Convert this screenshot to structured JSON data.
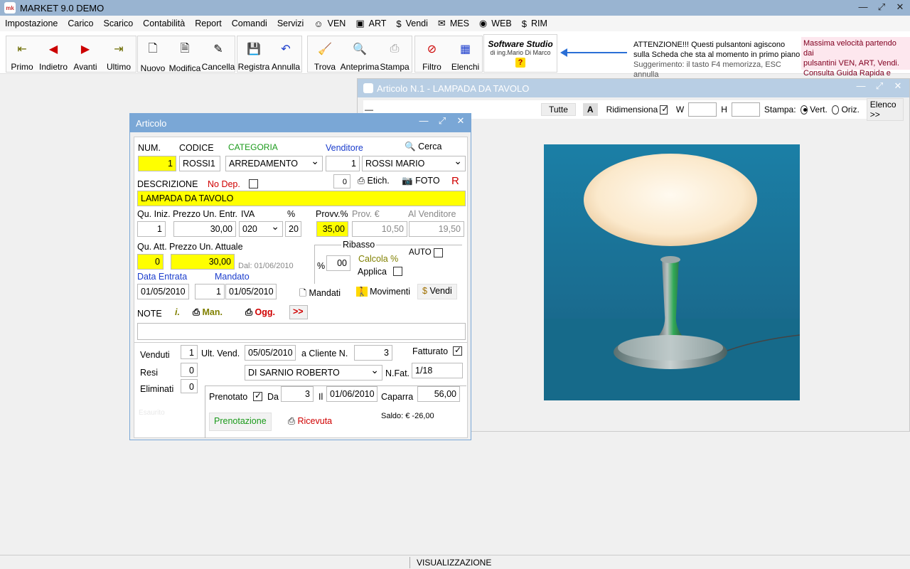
{
  "window": {
    "app_icon": "mk",
    "title": "MARKET 9.0   DEMO"
  },
  "menu": [
    {
      "label": "Impostazione",
      "icon": ""
    },
    {
      "label": "Carico",
      "icon": ""
    },
    {
      "label": "Scarico",
      "icon": ""
    },
    {
      "label": "Contabilità",
      "icon": ""
    },
    {
      "label": "Report",
      "icon": ""
    },
    {
      "label": "Comandi",
      "icon": ""
    },
    {
      "label": "Servizi",
      "icon": ""
    },
    {
      "label": "VEN",
      "icon": "☺"
    },
    {
      "label": "ART",
      "icon": "▣"
    },
    {
      "label": "Vendi",
      "icon": "$"
    },
    {
      "label": "MES",
      "icon": "✉"
    },
    {
      "label": "WEB",
      "icon": "◉"
    },
    {
      "label": "RIM",
      "icon": "$"
    }
  ],
  "toolbar": {
    "nav": [
      "Primo",
      "Indietro",
      "Avanti",
      "Ultimo"
    ],
    "edit": [
      "Nuovo",
      "Modifica",
      "Cancella"
    ],
    "save": [
      "Registra",
      "Annulla"
    ],
    "tools": [
      "Trova",
      "Anteprima",
      "Stampa"
    ],
    "filter": [
      "Filtro",
      "Elenchi"
    ],
    "brand_title": "Software Studio",
    "brand_sub": "di ing.Mario Di Marco",
    "help": "?",
    "attention_1": "ATTENZIONE!!! Questi pulsantoni agiscono",
    "attention_2": "sulla Scheda che sta al momento in primo piano",
    "attention_hint": "Suggerimento: il tasto F4 memorizza, ESC annulla",
    "pink_1": "Massima velocità partendo dai",
    "pink_2": "pulsantini VEN, ART, Vendi.",
    "pink_3": "Consulta Guida Rapida e Video"
  },
  "photo_window": {
    "title": "Articolo N.1 - LAMPADA DA TAVOLO",
    "tutte": "Tutte",
    "a": "A",
    "ridimensiona": "Ridimensiona",
    "w": "W",
    "h": "H",
    "stampa": "Stampa:",
    "vert": "Vert.",
    "oriz": "Oriz.",
    "elenco": "Elenco >>"
  },
  "articolo": {
    "title": "Articolo",
    "num_label": "NUM.",
    "num": "1",
    "codice_label": "CODICE",
    "codice": "ROSSI1",
    "categoria_label": "CATEGORIA",
    "categoria": "ARREDAMENTO",
    "venditore_label": "Venditore",
    "venditore_id": "1",
    "venditore": "ROSSI MARIO",
    "cerca": "Cerca",
    "descrizione_label": "DESCRIZIONE",
    "nodep_label": "No Dep.",
    "etich_count": "0",
    "etich": "Etich.",
    "foto": "FOTO",
    "r": "R",
    "descrizione": "LAMPADA DA TAVOLO",
    "qu_iniz_label": "Qu. Iniz.",
    "prezzo_entr_label": "Prezzo Un. Entr.",
    "iva_label": "IVA",
    "perc_label": "%",
    "provv_perc_label": "Provv.%",
    "provv_eur_label": "Prov. €",
    "al_vend_label": "Al Venditore",
    "qu_iniz": "1",
    "prezzo_entr": "30,00",
    "iva": "020",
    "perc": "20",
    "provv_perc": "35,00",
    "provv_eur": "10,50",
    "al_vend": "19,50",
    "qu_att_label": "Qu. Att.",
    "prezzo_att_label": "Prezzo Un. Attuale",
    "qu_att": "0",
    "prezzo_att": "30,00",
    "dal": "Dal: 01/06/2010",
    "ribasso_label": "Ribasso",
    "rib_perc_label": "%",
    "rib_perc": "00",
    "calcola": "Calcola %",
    "applica": "Applica",
    "auto": "AUTO",
    "data_entrata_label": "Data Entrata",
    "mandato_label": "Mandato",
    "data_entrata": "01/05/2010",
    "mandato_n": "1",
    "mandato_data": "01/05/2010",
    "mandati": "Mandati",
    "movimenti": "Movimenti",
    "vendi": "Vendi",
    "note_label": "NOTE",
    "info": "i.",
    "man": "Man.",
    "ogg": "Ogg.",
    "more": ">>",
    "venduti_label": "Venduti",
    "venduti": "1",
    "ult_vend_label": "Ult. Vend.",
    "ult_vend": "05/05/2010",
    "a_cliente_label": "a Cliente N.",
    "cliente_n": "3",
    "fatturato_label": "Fatturato",
    "resi_label": "Resi",
    "resi": "0",
    "cliente": "DI SARNIO ROBERTO",
    "nfat_label": "N.Fat.",
    "nfat": "1/18",
    "eliminati_label": "Eliminati",
    "eliminati": "0",
    "prenotato_label": "Prenotato",
    "da_label": "Da",
    "da": "3",
    "il_label": "Il",
    "il": "01/06/2010",
    "caparra_label": "Caparra",
    "caparra": "56,00",
    "esaurito": "Esaurito",
    "prenotazione": "Prenotazione",
    "ricevuta": "Ricevuta",
    "saldo": "Saldo:  €   -26,00"
  },
  "status": {
    "mode": "VISUALIZZAZIONE"
  }
}
